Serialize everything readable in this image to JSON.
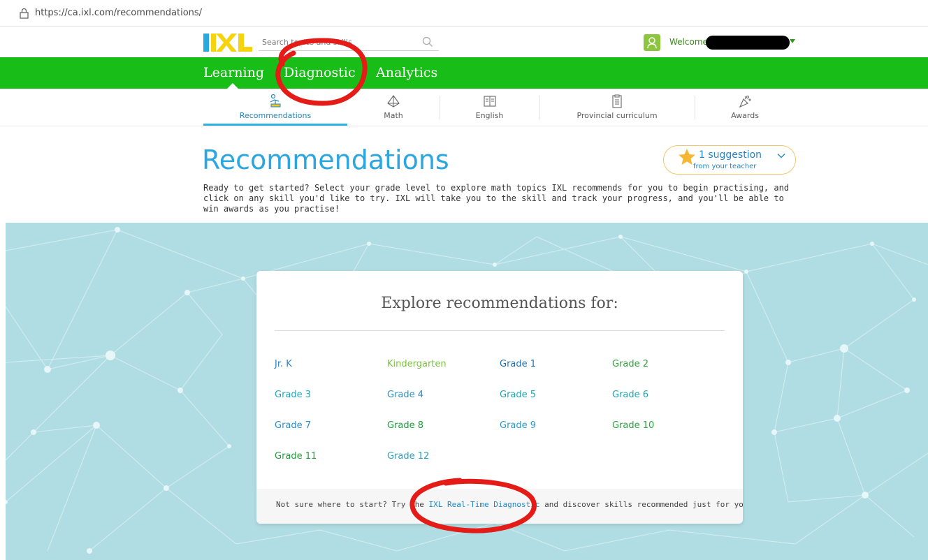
{
  "browser": {
    "url": "https://ca.ixl.com/recommendations/"
  },
  "header": {
    "search_placeholder": "Search topics and skills",
    "welcome_label": "Welcome"
  },
  "nav": {
    "tabs": [
      "Learning",
      "Diagnostic",
      "Analytics"
    ],
    "active": "Learning"
  },
  "subnav": {
    "items": [
      {
        "label": "Recommendations",
        "icon": "recommendations-icon"
      },
      {
        "label": "Math",
        "icon": "math-icon"
      },
      {
        "label": "English",
        "icon": "english-icon"
      },
      {
        "label": "Provincial curriculum",
        "icon": "curriculum-icon"
      },
      {
        "label": "Awards",
        "icon": "awards-icon"
      }
    ],
    "active": "Recommendations"
  },
  "page": {
    "title": "Recommendations",
    "intro": "Ready to get started? Select your grade level to explore math topics IXL recommends for you to begin practising, and click on any skill you'd like to try. IXL will take you to the skill and track your progress, and you'll be able to win awards as you practise!"
  },
  "suggestion": {
    "count_label": "1 suggestion",
    "from_label": "from your teacher"
  },
  "card": {
    "title": "Explore recommendations for:",
    "grades": [
      {
        "label": "Jr. K",
        "color": "#2c83c5"
      },
      {
        "label": "Kindergarten",
        "color": "#7ac143"
      },
      {
        "label": "Grade 1",
        "color": "#1f6fb0"
      },
      {
        "label": "Grade 2",
        "color": "#2ea33a"
      },
      {
        "label": "Grade 3",
        "color": "#20a8b8"
      },
      {
        "label": "Grade 4",
        "color": "#2a91c9"
      },
      {
        "label": "Grade 5",
        "color": "#1ea5b0"
      },
      {
        "label": "Grade 6",
        "color": "#1ea7b8"
      },
      {
        "label": "Grade 7",
        "color": "#2a8fc4"
      },
      {
        "label": "Grade 8",
        "color": "#18a03a"
      },
      {
        "label": "Grade 9",
        "color": "#2a9ac4"
      },
      {
        "label": "Grade 10",
        "color": "#26a63c"
      },
      {
        "label": "Grade 11",
        "color": "#22a03c"
      },
      {
        "label": "Grade 12",
        "color": "#2aa1bd"
      }
    ],
    "footer_prefix": "Not sure where to start? Try the ",
    "footer_link": "IXL Real-Time Diagnostic",
    "footer_suffix": " and discover skills recommended just for you!"
  },
  "colors": {
    "nav_green": "#18bd18",
    "title_blue": "#2ba6de",
    "band_bg": "#b0dde3",
    "annotation_red": "#e41b17"
  }
}
